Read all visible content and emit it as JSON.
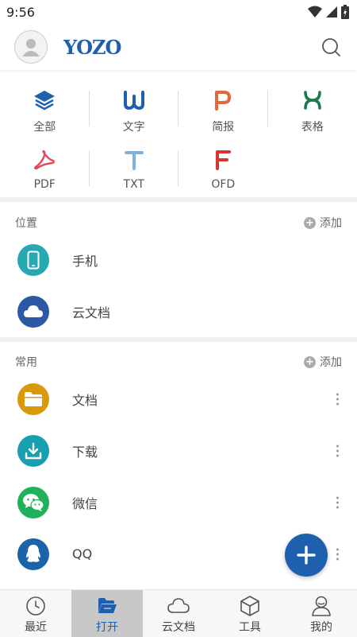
{
  "status_bar": {
    "time": "9:56"
  },
  "header": {
    "logo": "YOZO"
  },
  "file_types": [
    {
      "label": "全部",
      "glyph": "layers"
    },
    {
      "label": "文字",
      "glyph": "W"
    },
    {
      "label": "简报",
      "glyph": "P"
    },
    {
      "label": "表格",
      "glyph": "X"
    },
    {
      "label": "PDF",
      "glyph": "pdf"
    },
    {
      "label": "TXT",
      "glyph": "T"
    },
    {
      "label": "OFD",
      "glyph": "F"
    }
  ],
  "locations": {
    "title": "位置",
    "add_label": "添加",
    "items": [
      {
        "name": "手机",
        "icon": "phone-icon",
        "color": "#26a9b3"
      },
      {
        "name": "云文档",
        "icon": "cloud-icon",
        "color": "#2d58a6"
      }
    ]
  },
  "common": {
    "title": "常用",
    "add_label": "添加",
    "items": [
      {
        "name": "文档",
        "icon": "folder-icon",
        "color": "#d89a0a"
      },
      {
        "name": "下载",
        "icon": "download-icon",
        "color": "#19a0b0"
      },
      {
        "name": "微信",
        "icon": "wechat-icon",
        "color": "#20b25a"
      },
      {
        "name": "QQ",
        "icon": "qq-icon",
        "color": "#1c64a8"
      }
    ]
  },
  "bottom_nav": [
    {
      "label": "最近",
      "icon": "clock-icon"
    },
    {
      "label": "打开",
      "icon": "folder-open-icon",
      "active": true
    },
    {
      "label": "云文档",
      "icon": "cloud-icon"
    },
    {
      "label": "工具",
      "icon": "box-icon"
    },
    {
      "label": "我的",
      "icon": "person-icon"
    }
  ],
  "colors": {
    "accent": "#1e5fae",
    "word": "#1e5fae",
    "ppt": "#e0683c",
    "excel": "#1f7a4d",
    "pdf": "#e04a5f",
    "txt": "#7fb1dd",
    "ofd": "#d8362e"
  }
}
